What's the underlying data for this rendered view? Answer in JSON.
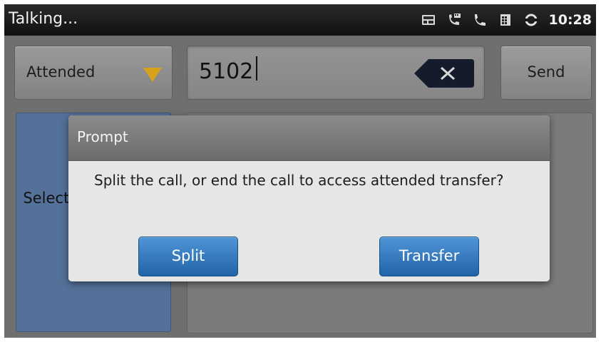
{
  "status_bar": {
    "title": "Talking...",
    "time": "10:28",
    "icons": [
      "voicemail-icon",
      "call-forward-icon",
      "phone-icon",
      "calendar-icon",
      "sync-icon"
    ]
  },
  "controls": {
    "transfer_mode": "Attended",
    "number_value": "5102",
    "send_label": "Send"
  },
  "left_panel": {
    "text": "Select call transfer"
  },
  "dialog": {
    "title": "Prompt",
    "message": "Split the call, or end the call to access attended transfer?",
    "split_label": "Split",
    "transfer_label": "Transfer"
  },
  "colors": {
    "dialog_button": "#2f78c0",
    "dropdown_arrow": "#d6a21a",
    "left_panel": "#54719a"
  }
}
